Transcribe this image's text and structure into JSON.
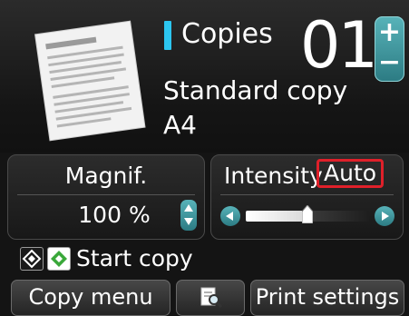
{
  "copies": {
    "label": "Copies",
    "count": "01",
    "increase_symbol": "+",
    "decrease_symbol": "−"
  },
  "copy_mode": "Standard copy",
  "paper_size": "A4",
  "magnification": {
    "label": "Magnif.",
    "value": "100 %"
  },
  "intensity": {
    "label": "Intensity",
    "value": "Auto",
    "level_fraction": 0.5
  },
  "start_hint": "Start copy",
  "buttons": {
    "copy_menu": "Copy menu",
    "print_settings": "Print settings"
  },
  "icons": {
    "document": "document-preview-icon",
    "preview": "magnifier-page-icon",
    "black_start": "black-start-key-icon",
    "color_start": "color-start-key-icon",
    "slider_left": "arrow-left-icon",
    "slider_right": "arrow-right-icon",
    "magnif_stepper": "up-down-arrows-icon"
  },
  "colors": {
    "copies_marker": "#2cc6f0",
    "stepper": "#3a959c",
    "highlight_border": "#e0202a",
    "color_key": "#3aa83a"
  }
}
